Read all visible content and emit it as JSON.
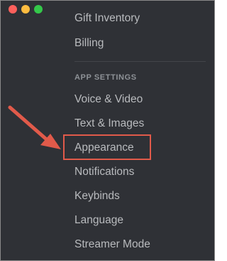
{
  "window": {
    "controls": [
      {
        "name": "close",
        "color": "#fc605c"
      },
      {
        "name": "minimize",
        "color": "#fdbc40"
      },
      {
        "name": "zoom",
        "color": "#34c84a"
      }
    ]
  },
  "sidebar": {
    "items_top": [
      "Gift Inventory",
      "Billing"
    ],
    "section_header": "APP SETTINGS",
    "items_app": [
      "Voice & Video",
      "Text & Images",
      "Appearance",
      "Notifications",
      "Keybinds",
      "Language",
      "Streamer Mode"
    ]
  },
  "annotation": {
    "highlighted_item": "Appearance",
    "color": "#e15a4a"
  }
}
